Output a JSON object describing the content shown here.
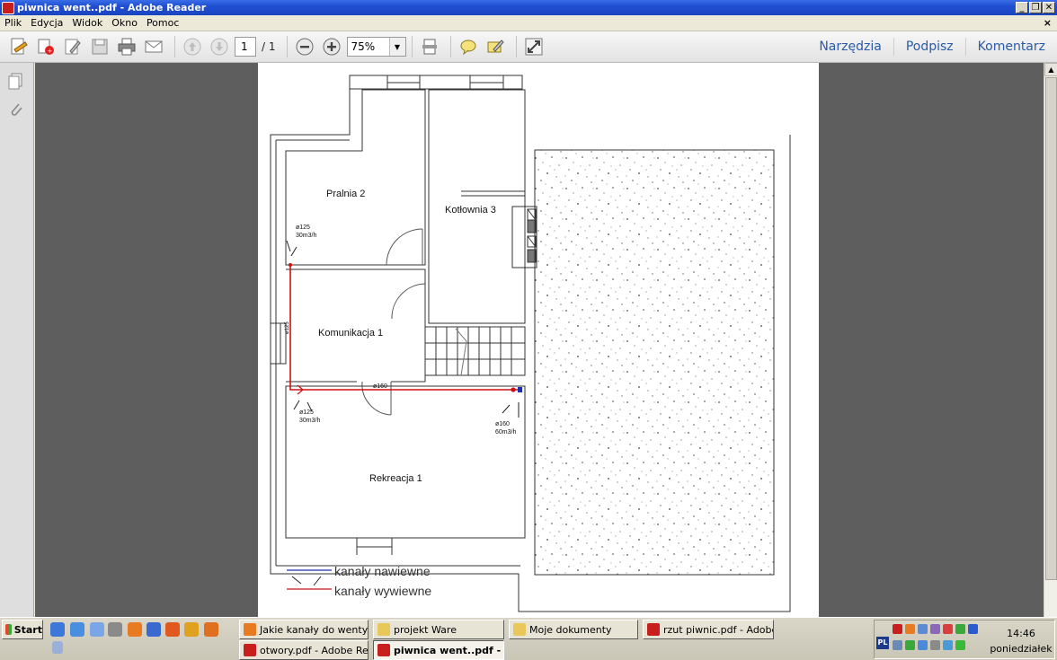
{
  "window": {
    "title": "piwnica went..pdf - Adobe Reader",
    "minimize": "_",
    "maximize": "❐",
    "close": "✕"
  },
  "menu": {
    "items": [
      "Plik",
      "Edycja",
      "Widok",
      "Okno",
      "Pomoc"
    ],
    "close_doc": "×"
  },
  "toolbar": {
    "page_current": "1",
    "page_total": "/ 1",
    "zoom": "75%",
    "links": [
      "Narzędzia",
      "Podpisz",
      "Komentarz"
    ]
  },
  "drawing": {
    "rooms": [
      "Pralnia 2",
      "Kotłownia 3",
      "Komunikacja 1",
      "Rekreacja 1"
    ],
    "labels": {
      "d125_top": "ø125",
      "flow_top": "30m3/h",
      "d125_vertical": "ø125",
      "d160_mid": "ø160",
      "d125_bottom": "ø125",
      "flow_bottom": "30m3/h",
      "d160_right": "ø160",
      "flow_right": "60m3/h"
    },
    "legend": [
      {
        "label": "kanały nawiewne",
        "color": "#1a2fb0"
      },
      {
        "label": "kanały wywiewne",
        "color": "#d01010"
      }
    ]
  },
  "taskbar": {
    "start": "Start",
    "tasks": [
      {
        "label": "Jakie kanały do wentylac...",
        "icon": "firefox-icon"
      },
      {
        "label": "projekt Ware",
        "icon": "folder-icon"
      },
      {
        "label": "Moje dokumenty",
        "icon": "folder-icon"
      },
      {
        "label": "rzut piwnic.pdf - Adobe ...",
        "icon": "pdf-icon"
      },
      {
        "label": "otwory.pdf - Adobe Rea...",
        "icon": "pdf-icon"
      },
      {
        "label": "piwnica went..pdf - Ad...",
        "icon": "pdf-icon"
      }
    ],
    "language": "PL",
    "time": "14:46",
    "day": "poniedziałek"
  }
}
